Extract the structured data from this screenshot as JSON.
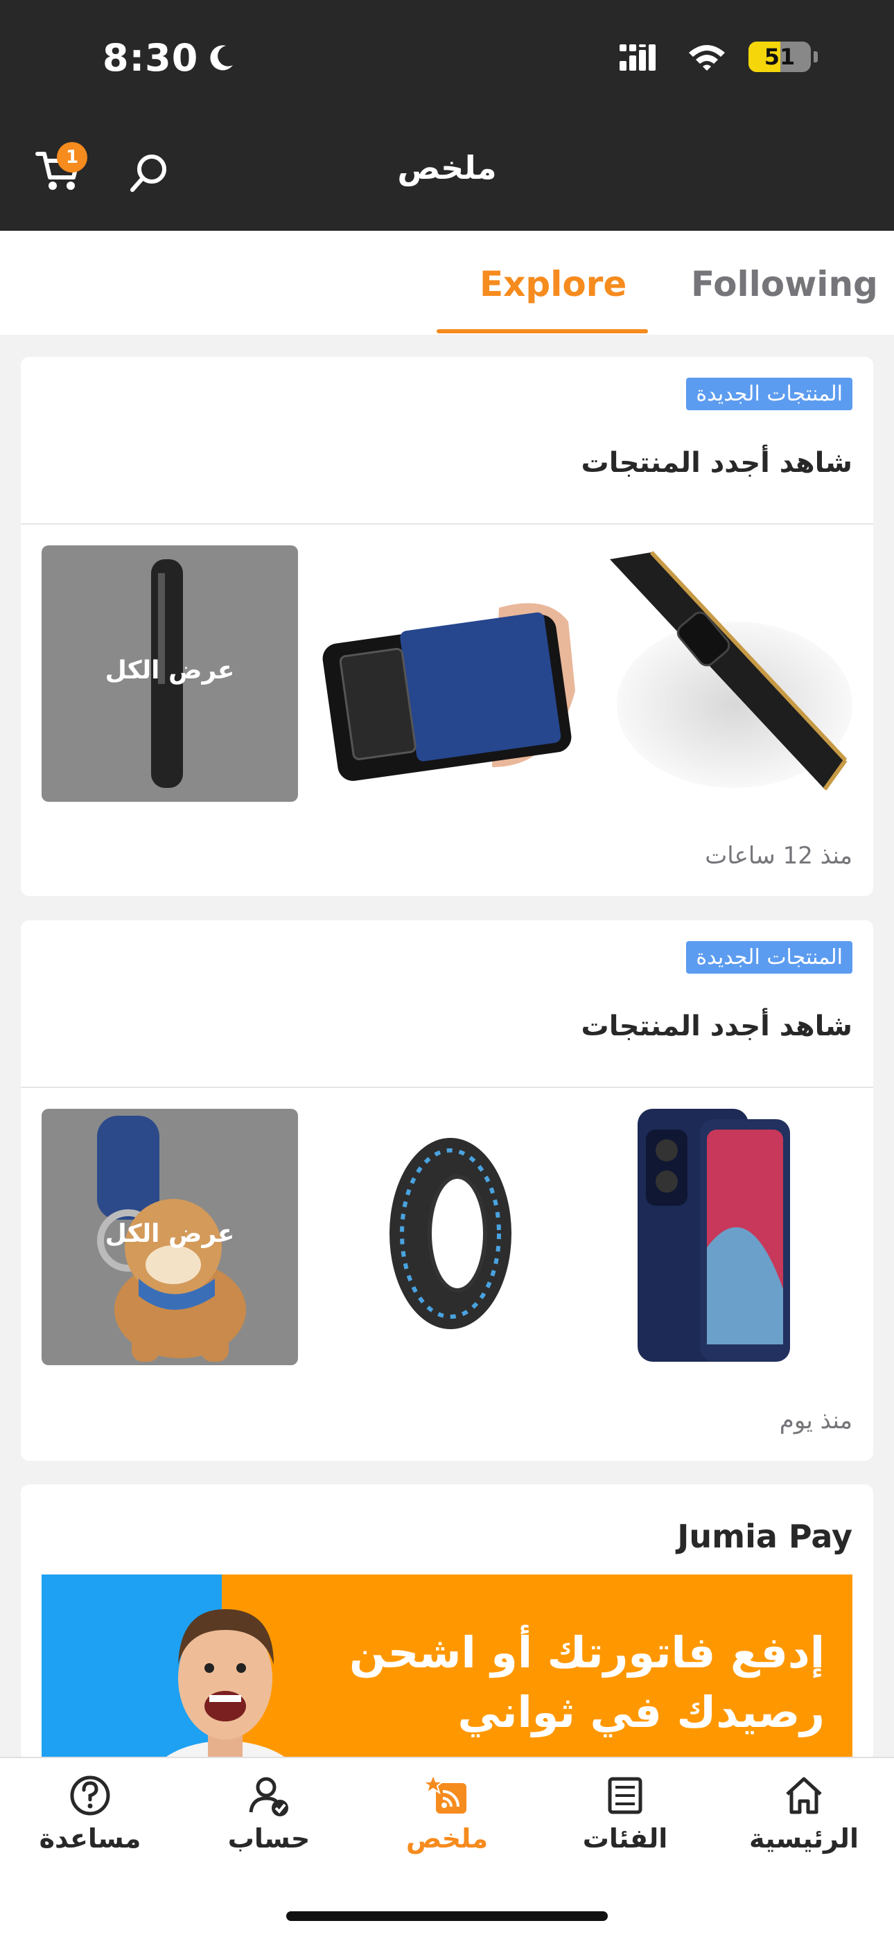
{
  "status_bar": {
    "time": "8:30",
    "battery": "51",
    "battery_level": 0.51
  },
  "header": {
    "title": "ملخص",
    "cart_count": "1",
    "icons": [
      "cart-icon",
      "search-icon"
    ]
  },
  "tabs": [
    {
      "label": "Explore",
      "active": true
    },
    {
      "label": "Following",
      "active": false
    }
  ],
  "feed": [
    {
      "badge": "المنتجات الجديدة",
      "title": "شاهد أجدد المنتجات",
      "view_all": "عرض الكل",
      "time_ago": "منذ 12 ساعات",
      "products": [
        "black-phone-case",
        "blue-leather-phone-case",
        "black-pen"
      ]
    },
    {
      "badge": "المنتجات الجديدة",
      "title": "شاهد أجدد المنتجات",
      "view_all": "عرض الكل",
      "time_ago": "منذ يوم",
      "products": [
        "navy-phone-case",
        "scooter-tire",
        "dog-keychain"
      ]
    }
  ],
  "jumia_pay": {
    "title": "Jumia Pay",
    "banner_line1": "إدفع فاتورتك أو اشحن",
    "banner_line2": "رصيدك في ثواني"
  },
  "bottom_nav": [
    {
      "label": "الرئيسية",
      "icon": "home-icon",
      "active": false
    },
    {
      "label": "الفئات",
      "icon": "categories-icon",
      "active": false
    },
    {
      "label": "ملخص",
      "icon": "feed-icon",
      "active": true
    },
    {
      "label": "حساب",
      "icon": "account-icon",
      "active": false
    },
    {
      "label": "مساعدة",
      "icon": "help-icon",
      "active": false
    }
  ],
  "colors": {
    "accent": "#f68b1e",
    "badge": "#5c9cf0",
    "header": "#282828"
  }
}
